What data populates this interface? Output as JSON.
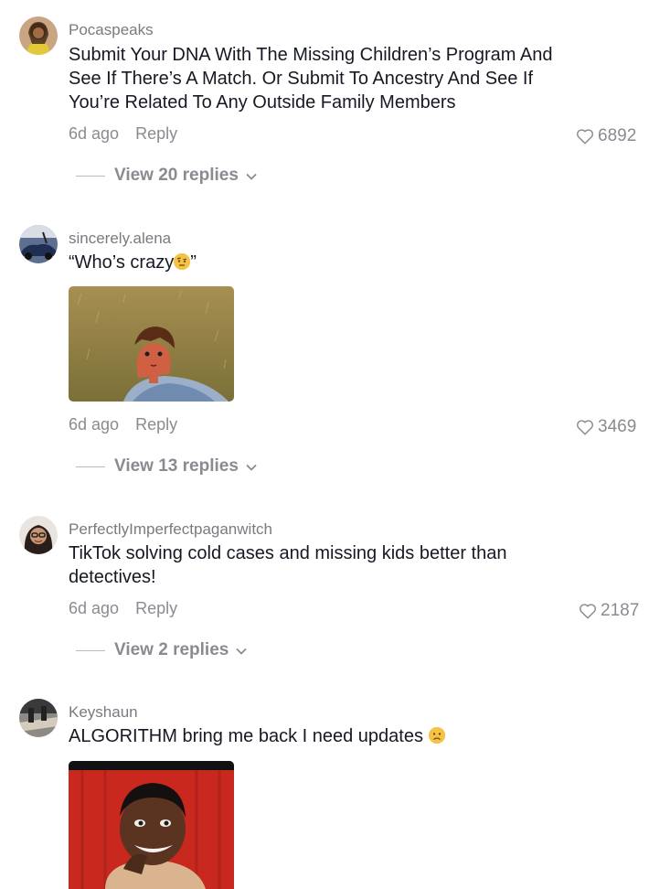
{
  "comments": [
    {
      "username": "Pocaspeaks",
      "text": "Submit Your DNA With The Missing Children’s Program And See If There’s A Match. Or Submit To Ancestry And See If You’re Related To Any Outside Family Members",
      "time": "6d ago",
      "reply_label": "Reply",
      "likes": "6892",
      "view_replies": "View 20 replies"
    },
    {
      "username": "sincerely.alena",
      "text_before": "“Who’s crazy",
      "text_after": "”",
      "time": "6d ago",
      "reply_label": "Reply",
      "likes": "3469",
      "view_replies": "View 13 replies",
      "emoji": "raised-eyebrow-face"
    },
    {
      "username": "PerfectlyImperfectpaganwitch",
      "text": "TikTok solving cold cases and missing kids better than detectives!",
      "time": "6d ago",
      "reply_label": "Reply",
      "likes": "2187",
      "view_replies": "View 2 replies"
    },
    {
      "username": "Keyshaun",
      "text": "ALGORITHM bring me back I need updates",
      "emoji": "frowning-face"
    }
  ],
  "colors": {
    "primary_text": "#161823",
    "secondary_text": "#8a8b91"
  }
}
